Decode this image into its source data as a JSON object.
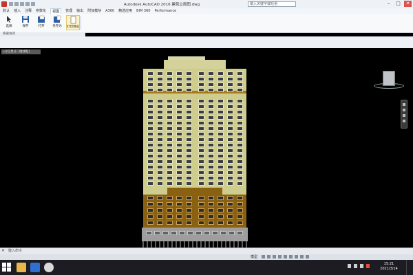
{
  "window": {
    "title": "Autodesk AutoCAD 2016   建筑立面图.dwg",
    "search_placeholder": "键入关键字或短语",
    "controls": {
      "minimize": "–",
      "maximize": "□",
      "close": "✕"
    }
  },
  "ribbon": {
    "tabs": [
      "默认",
      "插入",
      "注释",
      "参数化",
      "视图",
      "管理",
      "输出",
      "附加模块",
      "A360",
      "精选应用",
      "BIM 360",
      "Performance"
    ],
    "active_tab": "视图",
    "buttons": [
      {
        "label": "选择"
      },
      {
        "label": "保存"
      },
      {
        "label": "打开"
      },
      {
        "label": "另存为"
      },
      {
        "label": "打印预览"
      }
    ],
    "group_label": "快速访问"
  },
  "viewport": {
    "doc_tab": "[-][信息][二维线框]"
  },
  "command": {
    "close": "✕",
    "prompt": "键入命令"
  },
  "status": {
    "model_label": "模型"
  },
  "taskbar": {
    "time": "15:21",
    "date": "2021/3/14"
  },
  "colors": {
    "facade": "#cfcd8d",
    "podium": "#8a6110",
    "band": "#a97a1a",
    "base": "#9e9e9e",
    "background": "#000000"
  }
}
